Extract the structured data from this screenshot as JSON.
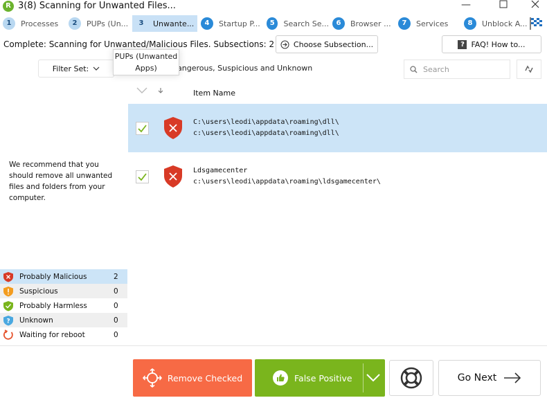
{
  "window": {
    "title": "3(8) Scanning for Unwanted Files...",
    "app_icon_letter": "R"
  },
  "steps": [
    {
      "num": "1",
      "label": "Processes"
    },
    {
      "num": "2",
      "label": "PUPs (Un..."
    },
    {
      "num": "3",
      "label": "Unwante..."
    },
    {
      "num": "4",
      "label": "Startup P..."
    },
    {
      "num": "5",
      "label": "Search Se..."
    },
    {
      "num": "6",
      "label": "Browser ..."
    },
    {
      "num": "7",
      "label": "Services"
    },
    {
      "num": "8",
      "label": "Unblock A..."
    }
  ],
  "status": {
    "complete_text": "Complete: Scanning for Unwanted/Malicious Files. Subsections: 2"
  },
  "toolbar": {
    "choose_subsection": "Choose Subsection...",
    "faq": "FAQ! How to...",
    "filter_label": "Filter Set:",
    "filter_desc": "angerous, Suspicious and Unknown",
    "search_placeholder": "Search"
  },
  "tooltip": {
    "line1": "PUPs (Unwanted",
    "line2": "Apps)"
  },
  "table": {
    "header_name": "Item Name",
    "rows": [
      {
        "line1": "C:\\users\\leodi\\appdata\\roaming\\dll\\",
        "line2": "c:\\users\\leodi\\appdata\\roaming\\dll\\"
      },
      {
        "line1": "Ldsgamecenter",
        "line2": "c:\\users\\leodi\\appdata\\roaming\\ldsgamecenter\\"
      }
    ]
  },
  "recommendation": "We recommend that you should remove all unwanted files and folders from your computer.",
  "legend": [
    {
      "label": "Probably Malicious",
      "count": "2",
      "icon": "red-shield-icon"
    },
    {
      "label": "Suspicious",
      "count": "0",
      "icon": "orange-shield-icon"
    },
    {
      "label": "Probably Harmless",
      "count": "0",
      "icon": "green-shield-icon"
    },
    {
      "label": "Unknown",
      "count": "0",
      "icon": "blue-shield-icon"
    },
    {
      "label": "Waiting for reboot",
      "count": "0",
      "icon": "reboot-icon"
    }
  ],
  "actions": {
    "remove": "Remove Checked",
    "false_positive": "False Positive",
    "next": "Go Next"
  },
  "colors": {
    "accent_blue": "#2a8ad8",
    "selected_row": "#cce4f7",
    "remove_button": "#f76a45",
    "false_positive_button": "#7ab51d",
    "malicious_red": "#d83a26"
  }
}
